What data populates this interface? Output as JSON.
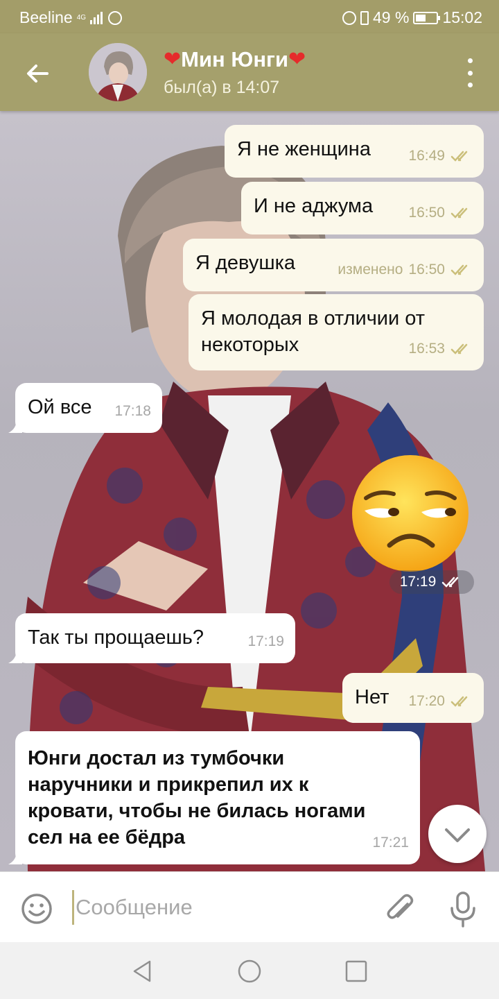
{
  "status_bar": {
    "carrier": "Beeline",
    "network": "4G",
    "battery": "49 %",
    "battery_level": 0.49,
    "time": "15:02"
  },
  "header": {
    "title": "Мин Юнги",
    "heart_glyph": "❤",
    "status": "был(а) в 14:07"
  },
  "messages": [
    {
      "dir": "out",
      "text": "Я не женщина",
      "time": "16:49",
      "read": true
    },
    {
      "dir": "out",
      "text": "И не аджума",
      "time": "16:50",
      "read": true
    },
    {
      "dir": "out",
      "text": "Я девушка",
      "edited": "изменено",
      "time": "16:50",
      "read": true
    },
    {
      "dir": "out",
      "text_lines": [
        "Я молодая в отличии от",
        "некоторых"
      ],
      "time": "16:53",
      "read": true
    },
    {
      "dir": "in",
      "text": "Ой все",
      "time": "17:18"
    },
    {
      "dir": "out",
      "type": "sticker",
      "emoji": "unamused-face",
      "time": "17:19",
      "read": true
    },
    {
      "dir": "in",
      "text": "Так ты прощаешь?",
      "time": "17:19"
    },
    {
      "dir": "out",
      "text": "Нет",
      "time": "17:20",
      "read": true
    },
    {
      "dir": "in",
      "bold": true,
      "text_lines": [
        "Юнги достал из тумбочки",
        "наручники и прикрепил их к",
        "кровати, чтобы не билась ногами",
        "сел на ее бёдра"
      ],
      "time": "17:21"
    }
  ],
  "input": {
    "placeholder": "Сообщение"
  },
  "icons": {
    "back": "arrow-left-icon",
    "menu": "more-vert-icon",
    "emoji": "smiley-icon",
    "attach": "paperclip-icon",
    "mic": "mic-icon",
    "scroll_down": "chevron-down-icon"
  },
  "colors": {
    "header": "#a5a06c",
    "status_bar": "#a39d69",
    "outgoing_bubble": "#fbf8ea",
    "incoming_bubble": "#ffffff",
    "check_marks": "#b5ae83"
  }
}
